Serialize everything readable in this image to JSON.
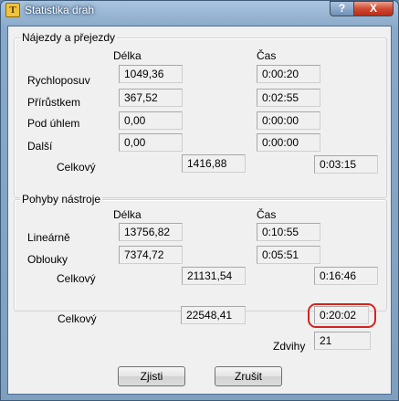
{
  "window": {
    "title": "Statistika drah",
    "help_label": "?",
    "close_label": "X",
    "icon_glyph": "T"
  },
  "headers": {
    "delka": "Délka",
    "cas": "Čas"
  },
  "group1": {
    "title": "Nájezdy a přejezdy",
    "rows": [
      {
        "label": "Rychloposuv",
        "delka": "1049,36",
        "cas": "0:00:20"
      },
      {
        "label": "Přírůstkem",
        "delka": "367,52",
        "cas": "0:02:55"
      },
      {
        "label": "Pod úhlem",
        "delka": "0,00",
        "cas": "0:00:00"
      },
      {
        "label": "Další",
        "delka": "0,00",
        "cas": "0:00:00"
      }
    ],
    "total": {
      "label": "Celkový",
      "delka": "1416,88",
      "cas": "0:03:15"
    }
  },
  "group2": {
    "title": "Pohyby nástroje",
    "rows": [
      {
        "label": "Lineárně",
        "delka": "13756,82",
        "cas": "0:10:55"
      },
      {
        "label": "Oblouky",
        "delka": "7374,72",
        "cas": "0:05:51"
      }
    ],
    "total": {
      "label": "Celkový",
      "delka": "21131,54",
      "cas": "0:16:46"
    }
  },
  "overall": {
    "label": "Celkový",
    "delka": "22548,41",
    "cas": "0:20:02",
    "zdvihy_label": "Zdvihy",
    "zdvihy": "21"
  },
  "buttons": {
    "zjisti": "Zjisti",
    "zrusit": "Zrušit"
  },
  "colors": {
    "highlight": "#d6221e",
    "close": "#c8412a"
  }
}
